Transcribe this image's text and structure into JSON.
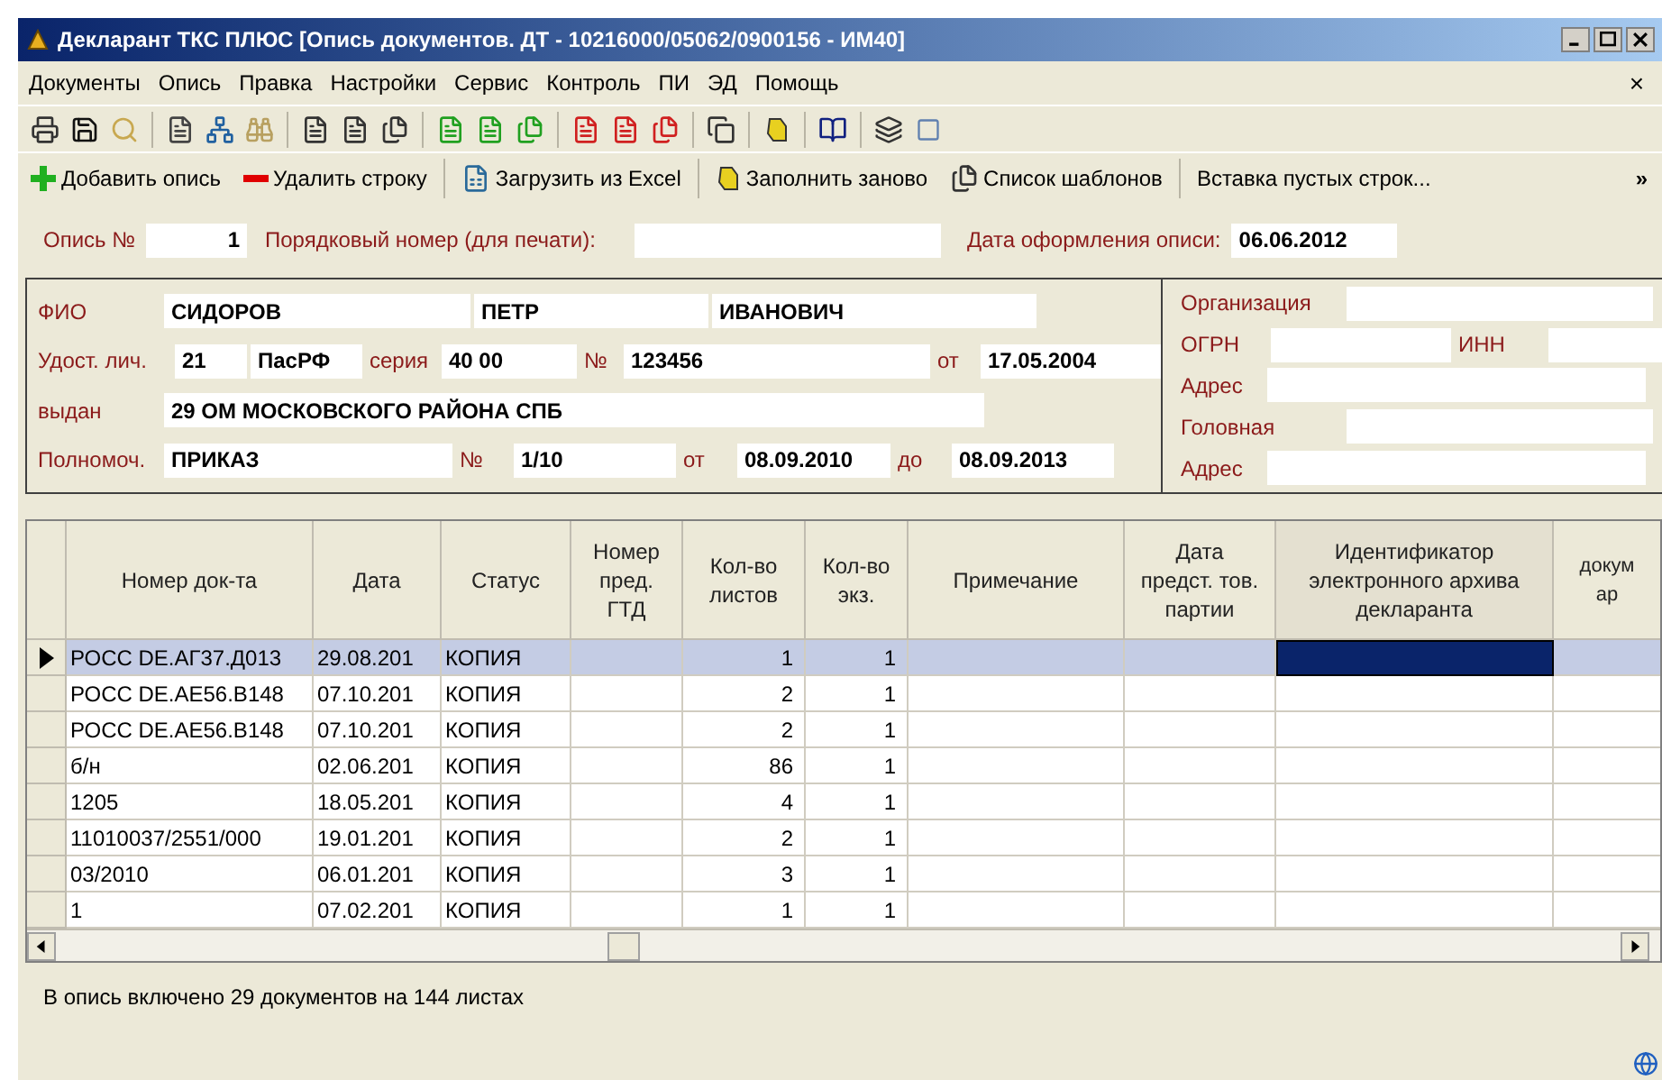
{
  "window": {
    "title": "Декларант ТКС ПЛЮС [Опись документов. ДТ - 10216000/05062/0900156 - ИМ40]"
  },
  "menu": [
    "Документы",
    "Опись",
    "Правка",
    "Настройки",
    "Сервис",
    "Контроль",
    "ПИ",
    "ЭД",
    "Помощь"
  ],
  "menu_close": "×",
  "toolbar": [
    {
      "label": "Добавить опись"
    },
    {
      "label": "Удалить строку"
    },
    {
      "label": "Загрузить из Excel"
    },
    {
      "label": "Заполнить заново"
    },
    {
      "label": "Список шаблонов"
    },
    {
      "label": "Вставка пустых строк..."
    }
  ],
  "toolbar_more": "»",
  "header": {
    "number_label": "Опись №",
    "number": "1",
    "print_label": "Порядковый номер (для печати):",
    "date_label": "Дата оформления описи:",
    "date": "06.06.2012"
  },
  "declarant": [
    [
      {
        "kind": "label",
        "text": "ФИО"
      },
      {
        "kind": "field",
        "value": "СИДОРОВ"
      },
      {
        "kind": "field",
        "value": "ПЕТР"
      },
      {
        "kind": "field",
        "value": "ИВАНОВИЧ"
      }
    ],
    [
      {
        "kind": "label",
        "text": "Удост. лич."
      },
      {
        "kind": "field",
        "value": "21"
      },
      {
        "kind": "field",
        "value": "ПасРФ"
      },
      {
        "kind": "label",
        "text": "серия"
      },
      {
        "kind": "field",
        "value": "40 00"
      },
      {
        "kind": "label",
        "text": "№"
      },
      {
        "kind": "field",
        "value": "123456"
      },
      {
        "kind": "label",
        "text": "от"
      },
      {
        "kind": "field",
        "value": "17.05.2004"
      }
    ],
    [
      {
        "kind": "label",
        "text": "выдан"
      },
      {
        "kind": "field",
        "value": "29 ОМ МОСКОВСКОГО РАЙОНА СПБ"
      }
    ],
    [
      {
        "kind": "label",
        "text": "Полномоч."
      },
      {
        "kind": "field",
        "value": "ПРИКАЗ"
      },
      {
        "kind": "label",
        "text": "№"
      },
      {
        "kind": "field",
        "value": "1/10"
      },
      {
        "kind": "label",
        "text": "от"
      },
      {
        "kind": "field",
        "value": "08.09.2010"
      },
      {
        "kind": "label",
        "text": "до"
      },
      {
        "kind": "field",
        "value": "08.09.2013"
      }
    ]
  ],
  "organization": [
    [
      {
        "kind": "label",
        "text": "Организация"
      },
      {
        "kind": "field"
      }
    ],
    [
      {
        "kind": "label",
        "text": "ОГРН"
      },
      {
        "kind": "field"
      },
      {
        "kind": "label",
        "text": "ИНН"
      },
      {
        "kind": "field"
      }
    ],
    [
      {
        "kind": "label",
        "text": "Адрес"
      },
      {
        "kind": "field"
      }
    ],
    [
      {
        "kind": "label",
        "text": "Головная"
      },
      {
        "kind": "field"
      }
    ],
    [
      {
        "kind": "label",
        "text": "Адрес"
      },
      {
        "kind": "field"
      }
    ]
  ],
  "table": {
    "columns": [
      {
        "lines": [
          "Номер док-та"
        ],
        "selected": false
      },
      {
        "lines": [
          "Дата"
        ],
        "selected": false
      },
      {
        "lines": [
          "Статус"
        ],
        "selected": false
      },
      {
        "lines": [
          "Номер",
          "пред.",
          "ГТД"
        ],
        "selected": false
      },
      {
        "lines": [
          "Кол-во",
          "листов"
        ],
        "selected": false
      },
      {
        "lines": [
          "Кол-во",
          "экз."
        ],
        "selected": false
      },
      {
        "lines": [
          "Примечание"
        ],
        "selected": false
      },
      {
        "lines": [
          "Дата",
          "предст. тов.",
          "партии"
        ],
        "selected": false
      },
      {
        "lines": [
          "Идентификатор",
          "электронного архива",
          "декларанта"
        ],
        "selected": true
      },
      {
        "lines": [
          "докум",
          "ар"
        ],
        "selected": false
      }
    ],
    "rows": [
      {
        "selected": true,
        "cells": [
          "РОСС DE.АГ37.Д013",
          "29.08.201",
          "КОПИЯ",
          "",
          "1",
          "1"
        ]
      },
      {
        "selected": false,
        "cells": [
          "РОСС DE.AE56.B148",
          "07.10.201",
          "КОПИЯ",
          "",
          "2",
          "1"
        ]
      },
      {
        "selected": false,
        "cells": [
          "РОСС DE.AE56.B148",
          "07.10.201",
          "КОПИЯ",
          "",
          "2",
          "1"
        ]
      },
      {
        "selected": false,
        "cells": [
          "б/н",
          "02.06.201",
          "КОПИЯ",
          "",
          "86",
          "1"
        ]
      },
      {
        "selected": false,
        "cells": [
          "1205",
          "18.05.201",
          "КОПИЯ",
          "",
          "4",
          "1"
        ]
      },
      {
        "selected": false,
        "cells": [
          "11010037/2551/000",
          "19.01.201",
          "КОПИЯ",
          "",
          "2",
          "1"
        ]
      },
      {
        "selected": false,
        "cells": [
          "03/2010",
          "06.01.201",
          "КОПИЯ",
          "",
          "3",
          "1"
        ]
      },
      {
        "selected": false,
        "cells": [
          "1",
          "07.02.201",
          "КОПИЯ",
          "",
          "1",
          "1"
        ]
      }
    ]
  },
  "status_bar": "В опись включено 29 документов на 144 листах"
}
